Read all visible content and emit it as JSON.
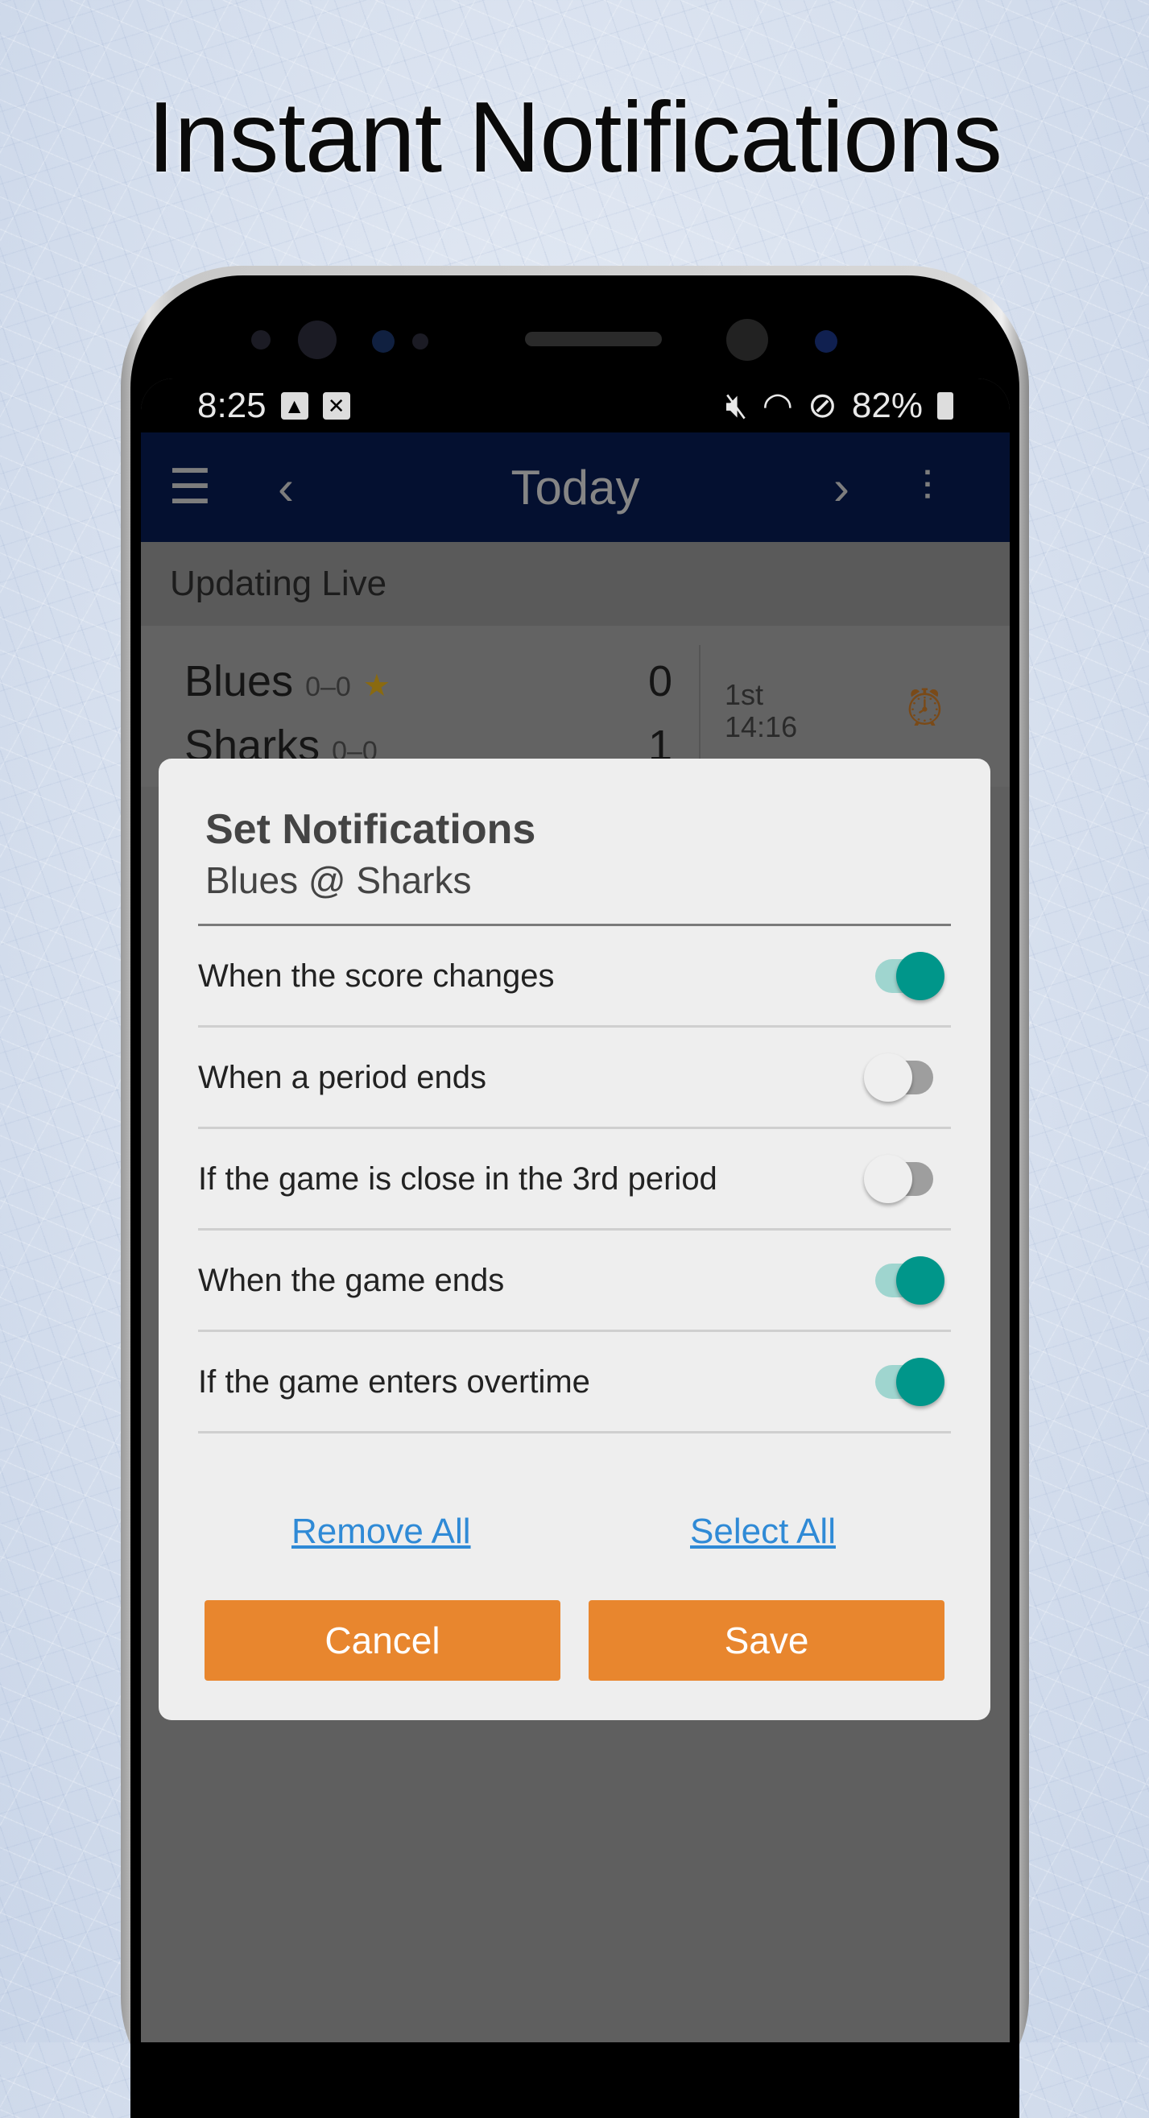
{
  "headline": "Instant Notifications",
  "status_bar": {
    "time": "8:25",
    "battery": "82%"
  },
  "app_bar": {
    "title": "Today"
  },
  "list": {
    "section": "Updating Live",
    "game": {
      "away": "Blues",
      "away_record": "0–0",
      "away_score": "0",
      "home": "Sharks",
      "home_record": "0–0",
      "home_score": "1",
      "period": "1st",
      "clock": "14:16"
    }
  },
  "dialog": {
    "title": "Set Notifications",
    "subtitle": "Blues @ Sharks",
    "options": [
      {
        "label": "When the score changes",
        "on": true
      },
      {
        "label": "When a period ends",
        "on": false
      },
      {
        "label": "If the game is close in the 3rd period",
        "on": false
      },
      {
        "label": "When the game ends",
        "on": true
      },
      {
        "label": "If the game enters overtime",
        "on": true
      }
    ],
    "remove_all": "Remove All",
    "select_all": "Select All",
    "cancel": "Cancel",
    "save": "Save"
  },
  "colors": {
    "accent": "#e8862e",
    "toggle_on": "#00968a",
    "link": "#2f8ad6"
  }
}
